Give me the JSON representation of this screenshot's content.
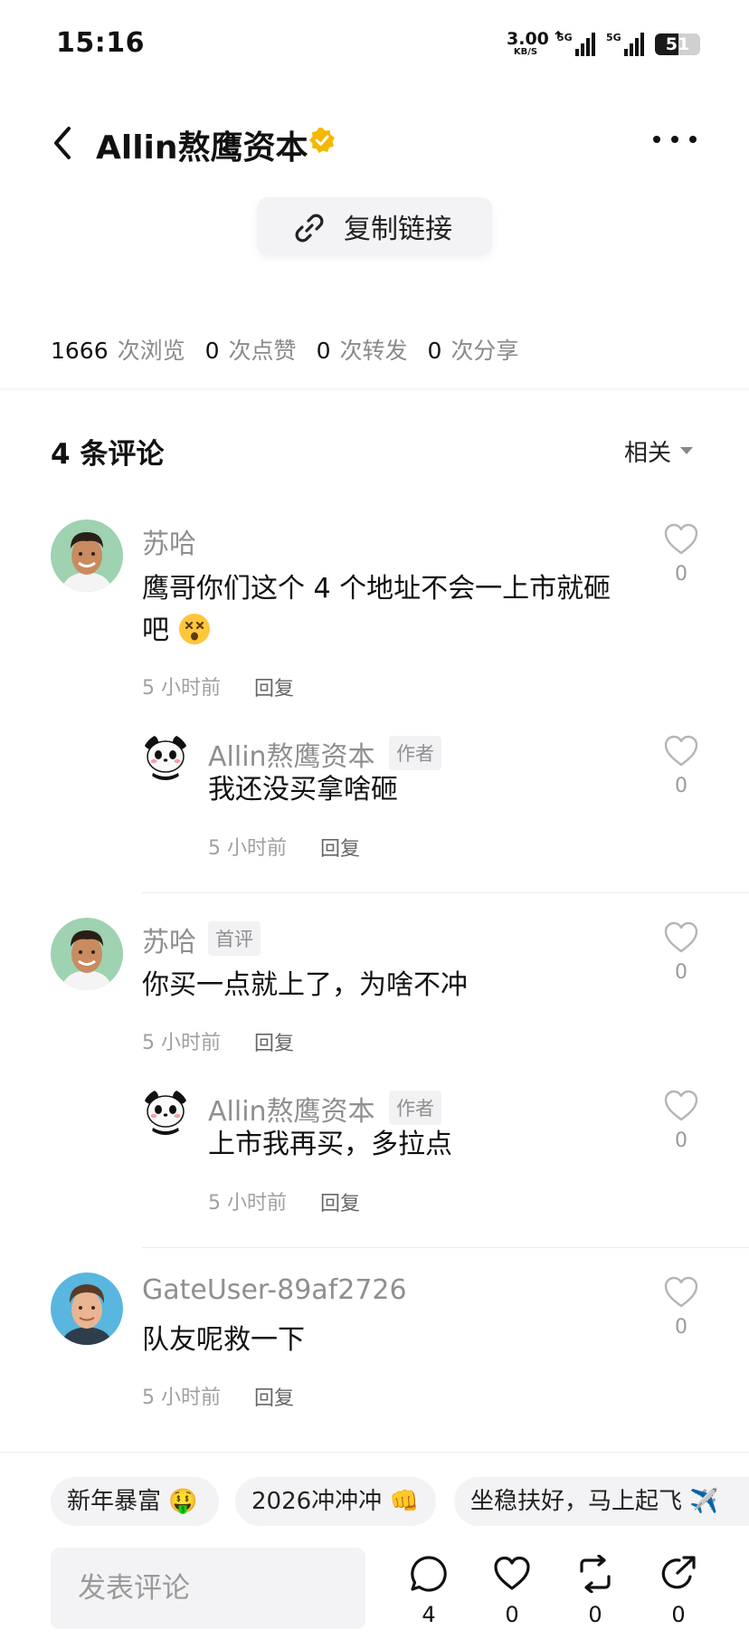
{
  "status_bar": {
    "time": "15:16",
    "net_speed": "3.00",
    "net_unit": "KB/S",
    "signal1_label": "5G",
    "signal2_label": "5G",
    "battery": "51"
  },
  "header": {
    "title": "Allin熬鹰资本"
  },
  "copy_link": {
    "label": "复制链接"
  },
  "stats": [
    {
      "value": "1666",
      "unit": "次浏览"
    },
    {
      "value": "0",
      "unit": "次点赞"
    },
    {
      "value": "0",
      "unit": "次转发"
    },
    {
      "value": "0",
      "unit": "次分享"
    }
  ],
  "comments_header": {
    "count_label": "4 条评论",
    "sort_label": "相关"
  },
  "comments": [
    {
      "name": "苏哈",
      "tag": "",
      "text_line1": "鹰哥你们这个 4 个地址不会一上市就砸",
      "text_line2": "吧",
      "time": "5 小时前",
      "reply_label": "回复",
      "likes": "0"
    },
    {
      "name": "Allin熬鹰资本",
      "tag": "作者",
      "text_line1": "我还没买拿啥砸",
      "time": "5 小时前",
      "reply_label": "回复",
      "likes": "0"
    },
    {
      "name": "苏哈",
      "tag": "首评",
      "text_line1": "你买一点就上了，为啥不冲",
      "time": "5 小时前",
      "reply_label": "回复",
      "likes": "0"
    },
    {
      "name": "Allin熬鹰资本",
      "tag": "作者",
      "text_line1": "上市我再买，多拉点",
      "time": "5 小时前",
      "reply_label": "回复",
      "likes": "0"
    },
    {
      "name": "GateUser-89af2726",
      "tag": "",
      "text_line1": "队友呢救一下",
      "time": "5 小时前",
      "reply_label": "回复",
      "likes": "0"
    }
  ],
  "quick_replies": [
    {
      "label": "新年暴富",
      "emoji": "🤑"
    },
    {
      "label": "2026冲冲冲",
      "emoji": "👊"
    },
    {
      "label": "坐稳扶好，马上起飞",
      "emoji": "✈️"
    }
  ],
  "bottom_bar": {
    "placeholder": "发表评论",
    "comments_count": "4",
    "likes_count": "0",
    "reposts_count": "0",
    "shares_count": "0"
  },
  "colors": {
    "verified": "#f5b800",
    "secondary_text": "#8f8f8f",
    "chip_bg": "#f3f3f5"
  }
}
